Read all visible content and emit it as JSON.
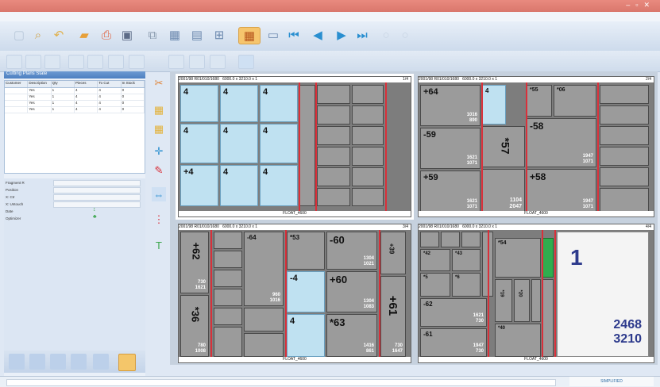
{
  "colors": {
    "titlebar": "#e07f74",
    "cut": "#d9303a",
    "selected_piece": "#bfe1f1",
    "grey_piece": "#9b9b9b",
    "green_piece": "#2fae4e"
  },
  "left_panel": {
    "title": "Cutting Plans State",
    "table_headers": [
      "Customer",
      "Description",
      "Qty",
      "Pieces",
      "To Cut",
      "In Stock"
    ],
    "rows": [
      {
        "c1": "",
        "c2": "Yes",
        "c3": "1",
        "c4": "4",
        "c5": "4",
        "c6": "0"
      },
      {
        "c1": "",
        "c2": "Yes",
        "c3": "1",
        "c4": "4",
        "c5": "4",
        "c6": "0"
      },
      {
        "c1": "",
        "c2": "Yes",
        "c3": "1",
        "c4": "4",
        "c5": "4",
        "c6": "0"
      },
      {
        "c1": "",
        "c2": "Yes",
        "c3": "1",
        "c4": "4",
        "c5": "4",
        "c6": "0"
      }
    ],
    "properties": [
      {
        "label": "Fragment R"
      },
      {
        "label": "Position"
      },
      {
        "label": "X: Ctr"
      },
      {
        "label": "X: Untouch"
      },
      {
        "label": "Date"
      },
      {
        "label": "Optimizer"
      }
    ]
  },
  "plates": [
    {
      "header": "2001/98 R01/010/1680",
      "size": "6000.0 x 3210.0 x 1",
      "page": "1/4",
      "footer": "FLOAT_4600"
    },
    {
      "header": "2001/98 R01/010/1680",
      "size": "6000.0 x 3210.0 x 1",
      "page": "2/4",
      "footer": "FLOAT_4600"
    },
    {
      "header": "2001/98 R01/010/1680",
      "size": "6000.0 x 3210.0 x 1",
      "page": "3/4",
      "footer": "FLOAT_4600"
    },
    {
      "header": "2001/98 R01/010/1680",
      "size": "6000.0 x 3210.0 x 1",
      "page": "4/4",
      "footer": "FLOAT_4600"
    }
  ],
  "p1": {
    "labels": [
      "4",
      "4",
      "4",
      "4",
      "4",
      "4",
      "+4",
      "4",
      "4"
    ]
  },
  "p2": {
    "l1": "+64",
    "d1a": "1016",
    "d1b": "890",
    "l2": "4",
    "l3": "*55",
    "l4": "*06",
    "l5": "-59",
    "d5a": "1621",
    "d5b": "1071",
    "l6": "*57",
    "l7": "-58",
    "d7a": "1947",
    "d7b": "1071",
    "l8": "+59",
    "d8a": "1621",
    "d8b": "1071",
    "l9": "1104",
    "l9b": "2047",
    "l10": "+58",
    "d10a": "1947",
    "d10b": "1071"
  },
  "p3": {
    "l1": "+62",
    "d1a": "730",
    "d1b": "1621",
    "l2": "*36",
    "d2a": "780",
    "d2b": "1008",
    "l3": "-64",
    "d3a": "960",
    "d3b": "1016",
    "l4": "*53",
    "l5": "-60",
    "d5a": "1304",
    "d5b": "1021",
    "l6": "-4",
    "l7": "+60",
    "d7a": "1304",
    "d7b": "1083",
    "l8": "4",
    "l9": "*63",
    "d9a": "1416",
    "d9b": "861",
    "l10": "+39",
    "l11": "+61",
    "d11a": "730",
    "d11b": "1647"
  },
  "p4": {
    "l1": "*42",
    "l2": "*43",
    "l3": "*5",
    "l4": "*6",
    "l5": "-62",
    "d5a": "1621",
    "d5b": "730",
    "l6": "-61",
    "d6a": "1947",
    "d6b": "730",
    "l7": "*54",
    "l8": "*19",
    "l9": "*20",
    "l10": "*40",
    "big": "1",
    "bigw": "2468",
    "bigh": "3210"
  },
  "status": {
    "text": "",
    "logo": "SIMPLIFIED"
  }
}
